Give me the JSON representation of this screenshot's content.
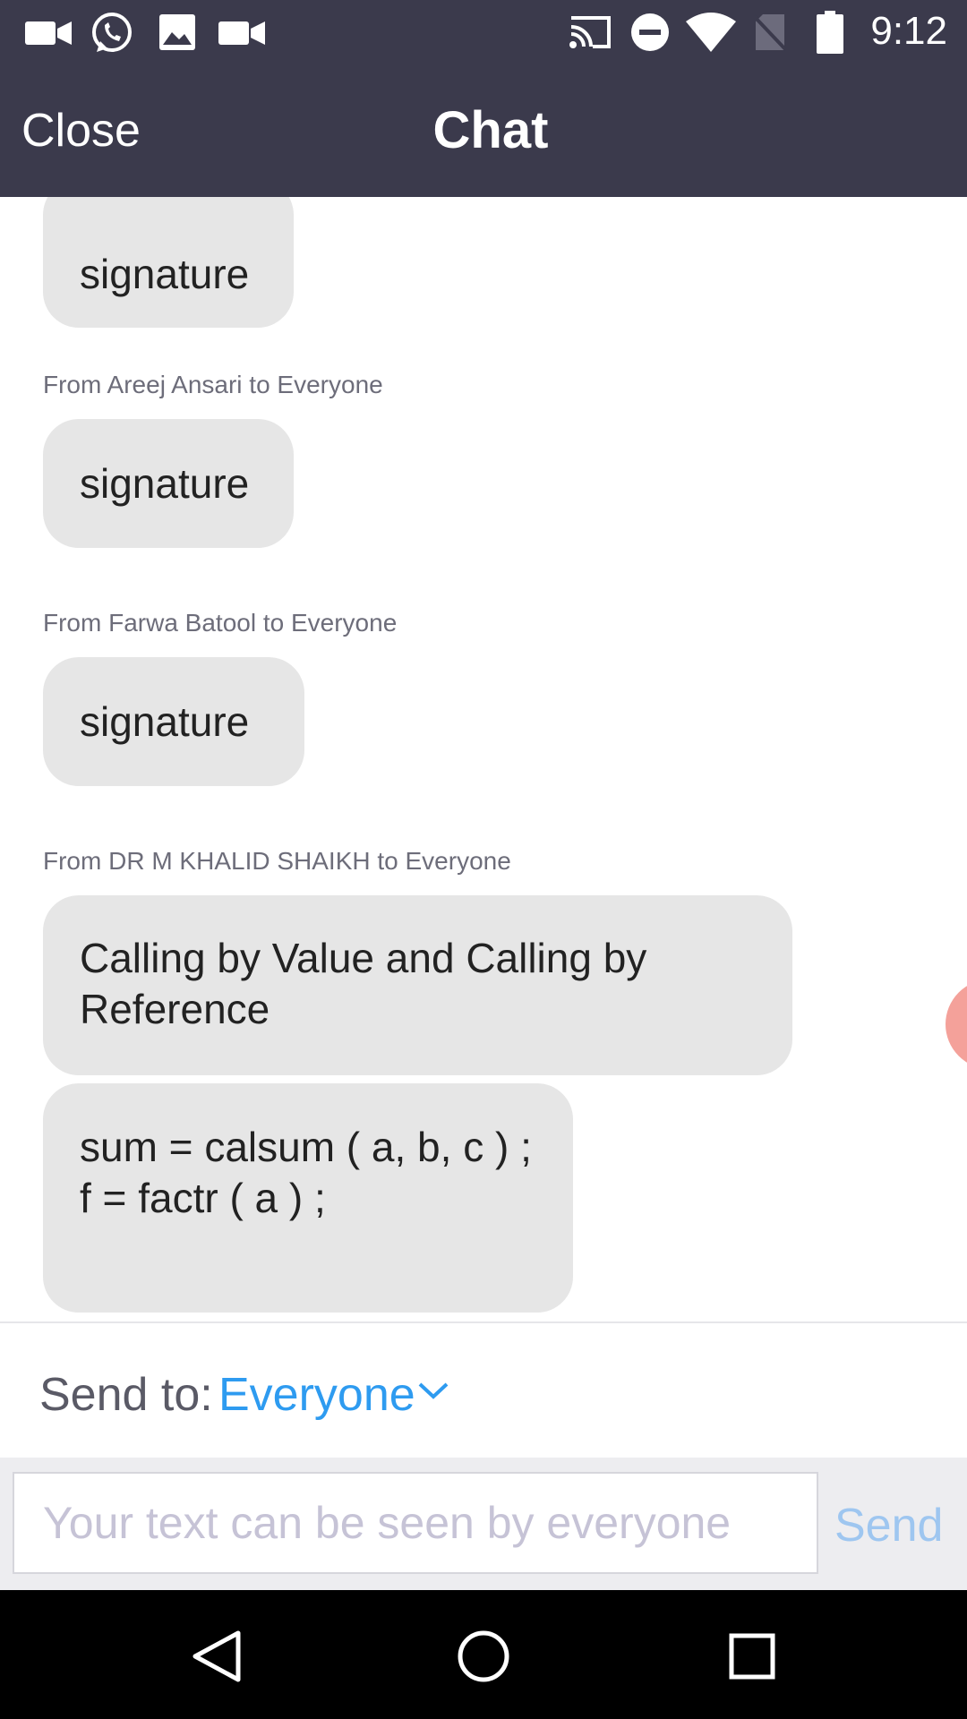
{
  "status_bar": {
    "time": "9:12",
    "left_icons": [
      "video-camera-icon",
      "whatsapp-icon",
      "image-icon",
      "video-camera-icon"
    ],
    "right_icons": [
      "cast-icon",
      "do-not-disturb-icon",
      "wifi-icon",
      "no-sim-icon",
      "battery-icon"
    ]
  },
  "header": {
    "close_label": "Close",
    "title": "Chat"
  },
  "messages": [
    {
      "sender": "",
      "bubbles": [
        "signature"
      ]
    },
    {
      "sender": "From Areej Ansari to Everyone",
      "bubbles": [
        "signature"
      ]
    },
    {
      "sender": "From Farwa Batool to Everyone",
      "bubbles": [
        "signature"
      ]
    },
    {
      "sender": "From DR M KHALID SHAIKH to Everyone",
      "bubbles": [
        [
          "Calling by Value and Calling by",
          "Reference"
        ],
        [
          "sum = calsum ( a, b, c ) ;",
          "f = factr ( a ) ;"
        ]
      ]
    }
  ],
  "send_to": {
    "label": "Send to:",
    "value": "Everyone"
  },
  "composer": {
    "placeholder": "Your text can be seen by everyone",
    "value": "",
    "send_label": "Send"
  },
  "nav_bar": {
    "buttons": [
      "back-icon",
      "home-icon",
      "recents-icon"
    ]
  },
  "colors": {
    "header_bg": "#3b3a4c",
    "accent": "#2e9bf0",
    "send_disabled": "#9ec6f0",
    "bubble_bg": "#e6e6e6"
  }
}
